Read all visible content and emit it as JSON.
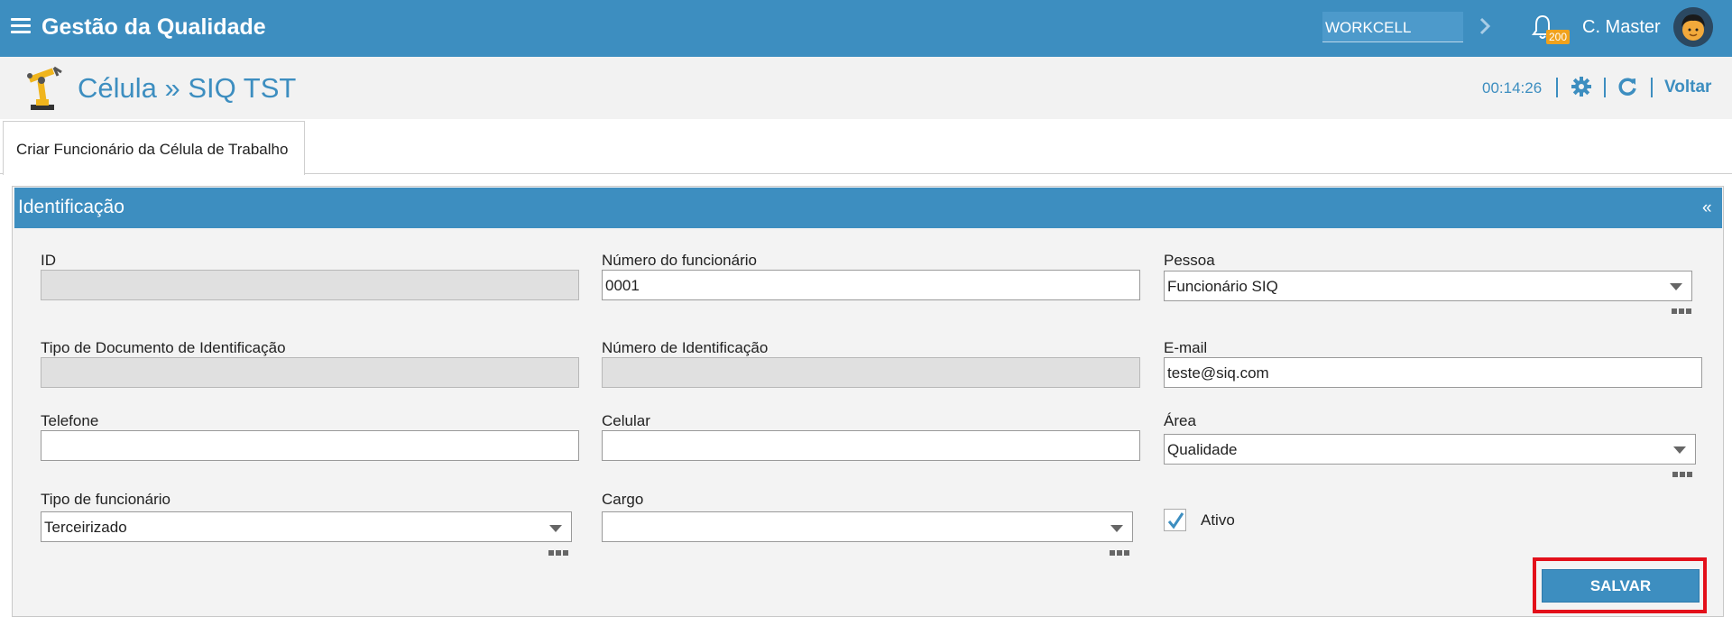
{
  "app": {
    "title": "Gestão da Qualidade"
  },
  "topbar": {
    "workcell": "WORKCELL",
    "notifications_count": "200",
    "user_name": "C. Master"
  },
  "header": {
    "title": "Célula » SIQ TST",
    "timer": "00:14:26",
    "back_label": "Voltar"
  },
  "tabs": [
    {
      "label": "Criar Funcionário da Célula de Trabalho"
    }
  ],
  "panel": {
    "title": "Identificação",
    "collapse_glyph": "«"
  },
  "form": {
    "id": {
      "label": "ID",
      "value": ""
    },
    "employee_number": {
      "label": "Número do funcionário",
      "value": "0001"
    },
    "person": {
      "label": "Pessoa",
      "value": "Funcionário SIQ"
    },
    "doc_type": {
      "label": "Tipo de Documento de Identificação",
      "value": ""
    },
    "id_number": {
      "label": "Número de Identificação",
      "value": ""
    },
    "email": {
      "label": "E-mail",
      "value": "teste@siq.com"
    },
    "phone": {
      "label": "Telefone",
      "value": ""
    },
    "mobile": {
      "label": "Celular",
      "value": ""
    },
    "area": {
      "label": "Área",
      "value": "Qualidade"
    },
    "employee_type": {
      "label": "Tipo de funcionário",
      "value": "Terceirizado"
    },
    "position": {
      "label": "Cargo",
      "value": ""
    },
    "active": {
      "label": "Ativo",
      "checked": true
    }
  },
  "actions": {
    "save_label": "SALVAR"
  },
  "colors": {
    "brand": "#3d8ec0",
    "highlight": "#e3101a",
    "badge": "#f0a21d"
  }
}
